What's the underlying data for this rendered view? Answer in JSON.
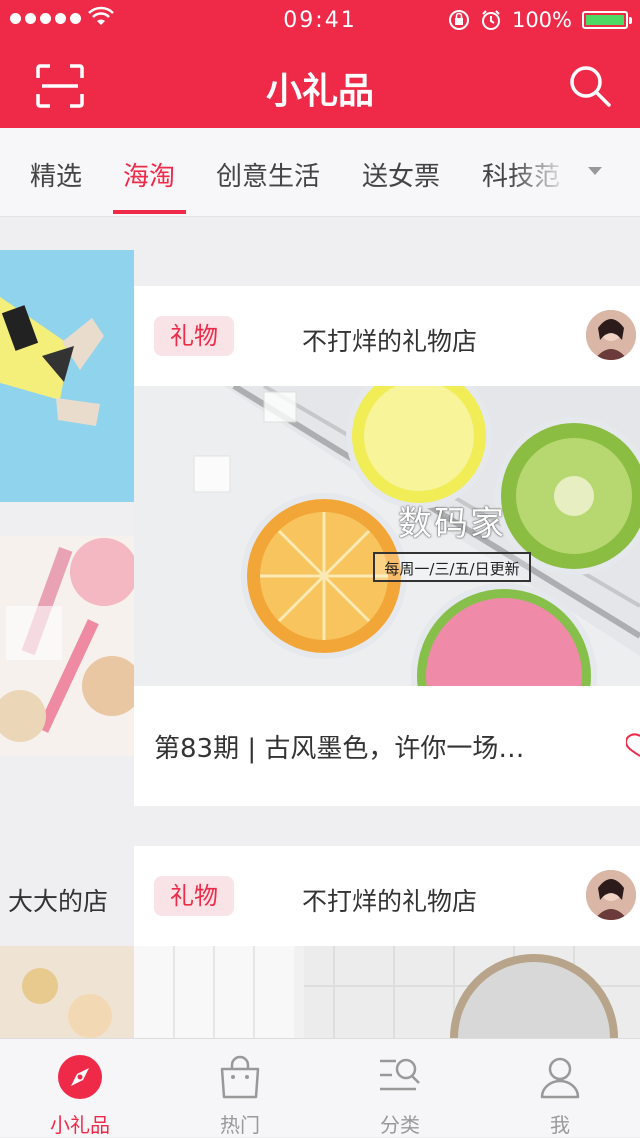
{
  "status": {
    "time": "09:41",
    "battery": "100%"
  },
  "nav": {
    "title": "小礼品"
  },
  "tabs": [
    {
      "label": "精选"
    },
    {
      "label": "海淘"
    },
    {
      "label": "创意生活"
    },
    {
      "label": "送女票"
    },
    {
      "label": "科技范"
    }
  ],
  "active_tab": "海淘",
  "cards": [
    {
      "tag": "礼物",
      "shop": "不打烊的礼物店",
      "hero_title": "数码家",
      "hero_badge": "每周一/三/五/日更新",
      "caption": "第83期 | 古风墨色，许你一场…"
    },
    {
      "tag": "礼物",
      "shop": "不打烊的礼物店"
    }
  ],
  "peek_shop": "大大的店",
  "tabbar": [
    {
      "label": "小礼品"
    },
    {
      "label": "热门"
    },
    {
      "label": "分类"
    },
    {
      "label": "我"
    }
  ],
  "colors": {
    "accent": "#ef2a48",
    "tag_bg": "#f9e3e6",
    "inactive": "#999999"
  }
}
